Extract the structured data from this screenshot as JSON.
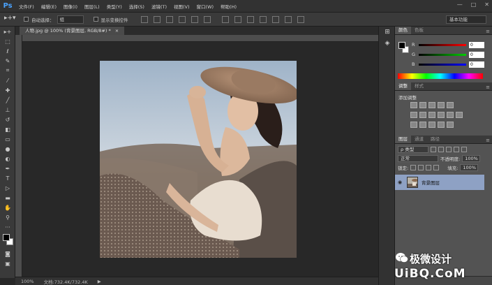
{
  "app": {
    "logo": "Ps"
  },
  "menu": [
    "文件(F)",
    "编辑(E)",
    "图像(I)",
    "图层(L)",
    "类型(Y)",
    "选择(S)",
    "滤镜(T)",
    "视图(V)",
    "窗口(W)",
    "帮助(H)"
  ],
  "window_controls": [
    "—",
    "□",
    "✕"
  ],
  "options": {
    "auto_select_label": "自动选择：",
    "auto_select_value": "组",
    "show_transform_label": "显示变换控件",
    "workspace": "基本功能"
  },
  "document": {
    "tab_title": "人物.jpg @ 100% (背景图层, RGB/8#) *",
    "close_glyph": "×"
  },
  "status": {
    "zoom": "100%",
    "doc_size": "文档:732.4K/732.4K"
  },
  "color_panel": {
    "tabs": [
      "颜色",
      "色板"
    ],
    "sliders": [
      {
        "letter": "R",
        "value": "0",
        "color": "#ff0000"
      },
      {
        "letter": "G",
        "value": "0",
        "color": "#00cc00"
      },
      {
        "letter": "B",
        "value": "0",
        "color": "#0000ff"
      }
    ]
  },
  "adjust_panel": {
    "tabs": [
      "调整",
      "样式"
    ],
    "title": "添加调整"
  },
  "layers_panel": {
    "tabs": [
      "图层",
      "通道",
      "路径"
    ],
    "filter": "ρ 类型",
    "blend_mode": "正常",
    "opacity_label": "不透明度:",
    "opacity": "100%",
    "lock_label": "锁定:",
    "fill_label": "填充:",
    "fill": "100%",
    "layers": [
      {
        "name": "背景图层",
        "visible": true
      }
    ]
  },
  "watermark": {
    "line1": "极微设计",
    "line2": "UiBQ.CoM"
  },
  "colors": {
    "accent": "#4aa3ff",
    "layer_selected": "#8ea1c4",
    "ui_dark": "#282828"
  }
}
